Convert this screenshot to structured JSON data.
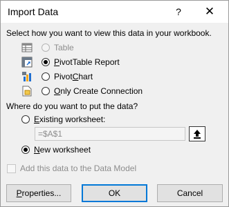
{
  "window": {
    "title": "Import Data",
    "help": "?",
    "close": "✕"
  },
  "view_section": {
    "prompt": "Select how you want to view this data in your workbook.",
    "options": [
      {
        "icon": "table-icon",
        "label": "Table",
        "selected": false,
        "disabled": true
      },
      {
        "icon": "pivottable-icon",
        "label": "PivotTable Report",
        "selected": true,
        "disabled": false
      },
      {
        "icon": "pivotchart-icon",
        "label": "PivotChart",
        "selected": false,
        "disabled": false
      },
      {
        "icon": "connection-icon",
        "label": "Only Create Connection",
        "selected": false,
        "disabled": false
      }
    ]
  },
  "location_section": {
    "prompt": "Where do you want to put the data?",
    "existing_label": "Existing worksheet:",
    "existing_value": "=$A$1",
    "new_label": "New worksheet",
    "selected": "new"
  },
  "data_model": {
    "label": "Add this data to the Data Model",
    "checked": false,
    "disabled": true
  },
  "buttons": {
    "properties": "Properties...",
    "ok": "OK",
    "cancel": "Cancel"
  },
  "colors": {
    "default_button_border": "#0078d7",
    "disabled_text": "#8d8d8d"
  }
}
